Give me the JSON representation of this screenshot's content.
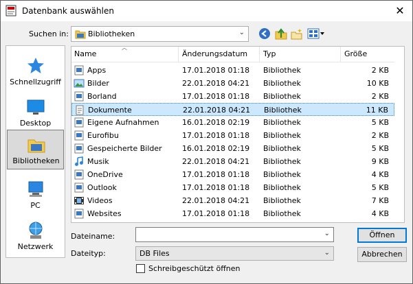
{
  "window": {
    "title": "Datenbank auswählen"
  },
  "toolbar": {
    "lookin_label": "Suchen in:",
    "lookin_value": "Bibliotheken"
  },
  "places": [
    {
      "label": "Schnellzugriff",
      "icon": "star-icon"
    },
    {
      "label": "Desktop",
      "icon": "desktop-icon"
    },
    {
      "label": "Bibliotheken",
      "icon": "libraries-icon"
    },
    {
      "label": "PC",
      "icon": "computer-icon"
    },
    {
      "label": "Netzwerk",
      "icon": "network-icon"
    }
  ],
  "list": {
    "columns": [
      "Name",
      "Änderungsdatum",
      "Typ",
      "Größe"
    ],
    "rows": [
      {
        "name": "Apps",
        "date": "17.01.2018 01:18",
        "type": "Bibliothek",
        "size": "2 KB"
      },
      {
        "name": "Bilder",
        "date": "22.01.2018 04:21",
        "type": "Bibliothek",
        "size": "10 KB"
      },
      {
        "name": "Borland",
        "date": "17.01.2018 01:18",
        "type": "Bibliothek",
        "size": "2 KB"
      },
      {
        "name": "Dokumente",
        "date": "22.01.2018 04:21",
        "type": "Bibliothek",
        "size": "11 KB"
      },
      {
        "name": "Eigene Aufnahmen",
        "date": "16.01.2018 02:19",
        "type": "Bibliothek",
        "size": "5 KB"
      },
      {
        "name": "Eurofibu",
        "date": "17.01.2018 01:18",
        "type": "Bibliothek",
        "size": "2 KB"
      },
      {
        "name": "Gespeicherte Bilder",
        "date": "16.01.2018 02:19",
        "type": "Bibliothek",
        "size": "5 KB"
      },
      {
        "name": "Musik",
        "date": "22.01.2018 04:21",
        "type": "Bibliothek",
        "size": "9 KB"
      },
      {
        "name": "OneDrive",
        "date": "17.01.2018 01:18",
        "type": "Bibliothek",
        "size": "4 KB"
      },
      {
        "name": "Outlook",
        "date": "17.01.2018 01:18",
        "type": "Bibliothek",
        "size": "5 KB"
      },
      {
        "name": "Videos",
        "date": "22.01.2018 04:21",
        "type": "Bibliothek",
        "size": "7 KB"
      },
      {
        "name": "Websites",
        "date": "17.01.2018 01:18",
        "type": "Bibliothek",
        "size": "4 KB"
      }
    ]
  },
  "form": {
    "filename_label": "Dateiname:",
    "filename_value": "",
    "filetype_label": "Dateityp:",
    "filetype_value": "DB Files",
    "readonly_label": "Schreibgeschützt öffnen"
  },
  "buttons": {
    "open": "Öffnen",
    "cancel": "Abbrechen"
  }
}
